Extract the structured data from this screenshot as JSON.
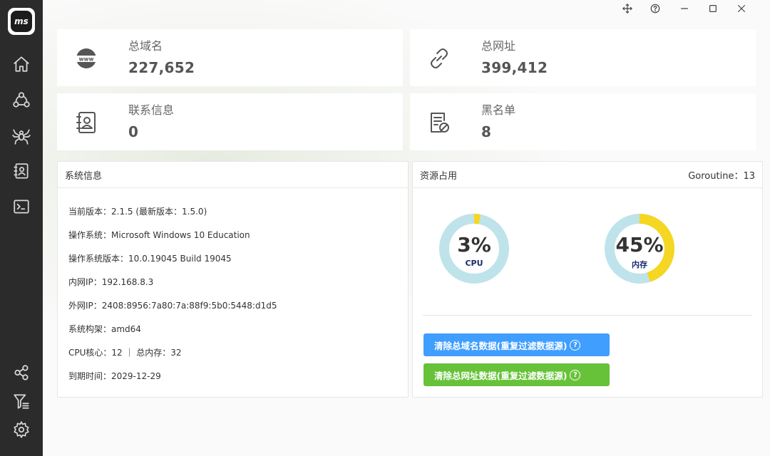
{
  "app": {
    "logo_text": "ms"
  },
  "stats": [
    {
      "label": "总域名",
      "value": "227,652",
      "icon": "www-icon"
    },
    {
      "label": "总网址",
      "value": "399,412",
      "icon": "link-icon"
    },
    {
      "label": "联系信息",
      "value": "0",
      "icon": "contact-book-icon"
    },
    {
      "label": "黑名单",
      "value": "8",
      "icon": "blacklist-doc-icon"
    }
  ],
  "system_panel": {
    "title": "系统信息",
    "lines": [
      "当前版本：2.1.5 (最新版本：1.5.0)",
      "操作系统：Microsoft Windows 10 Education",
      "操作系统版本：10.0.19045 Build 19045",
      "内网IP：192.168.8.3",
      "外网IP：2408:8956:7a80:7a:88f9:5b0:5448:d1d5",
      "系统构架：amd64",
      "CPU核心：12 ｜ 总内存：32",
      "到期时间：2029-12-29"
    ]
  },
  "resource_panel": {
    "title": "资源占用",
    "goroutine": "Goroutine：13",
    "gauges": [
      {
        "label": "CPU",
        "percent_text": "3%",
        "value": 3
      },
      {
        "label": "内存",
        "percent_text": "45%",
        "value": 45
      }
    ],
    "buttons": [
      {
        "label": "清除总域名数据(重复过滤数据源)",
        "color": "#409eff"
      },
      {
        "label": "清除总网址数据(重复过滤数据源)",
        "color": "#67c23a"
      }
    ]
  },
  "colors": {
    "gauge_track": "#bfe3ea",
    "gauge_fill": "#f5d622",
    "sidebar_bg": "#2b2b2b"
  }
}
